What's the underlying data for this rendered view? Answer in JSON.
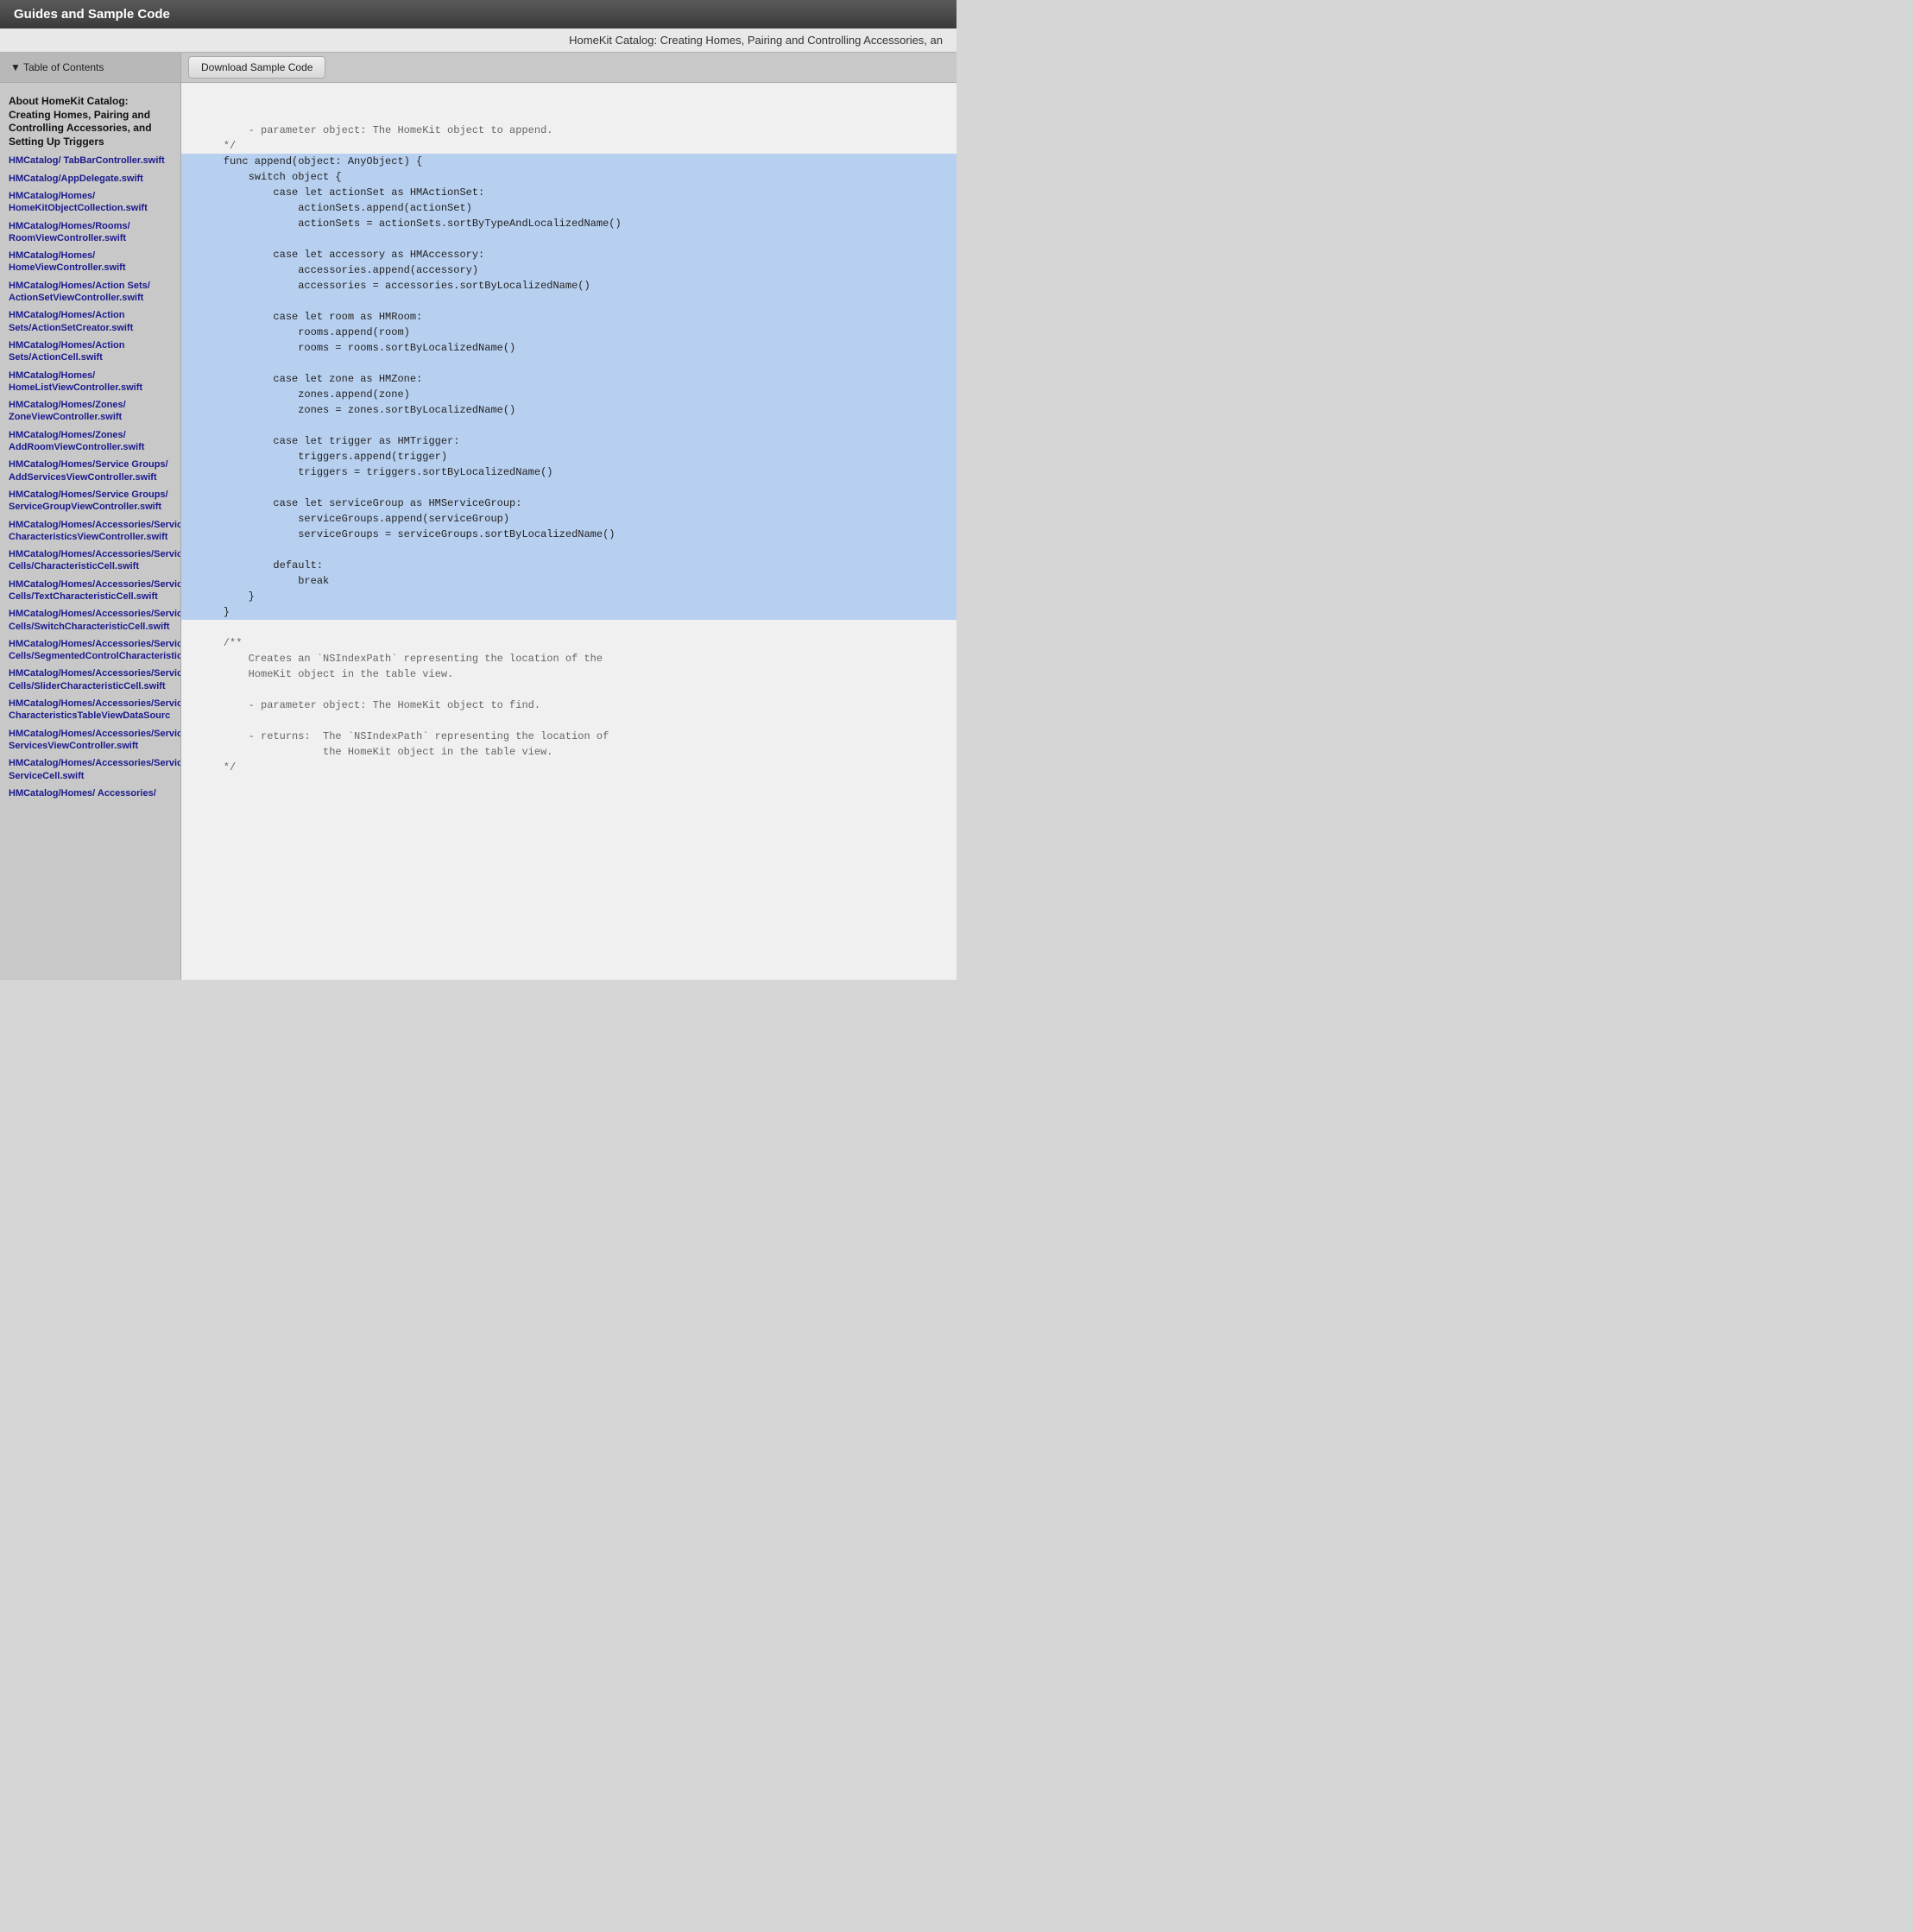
{
  "title_bar": {
    "label": "Guides and Sample Code"
  },
  "header_bar": {
    "page_title": "HomeKit Catalog: Creating Homes, Pairing and Controlling Accessories, an"
  },
  "toolbar": {
    "toc_toggle_label": "▼  Table of Contents",
    "download_button_label": "Download Sample Code"
  },
  "sidebar": {
    "sections": [
      {
        "id": "about",
        "label": "About HomeKit Catalog: Creating Homes, Pairing and Controlling Accessories, and Setting Up Triggers"
      }
    ],
    "items": [
      {
        "id": "tabbar",
        "label": "HMCatalog/\nTabBarController.swift"
      },
      {
        "id": "appdelegate",
        "label": "HMCatalog/AppDelegate.swift"
      },
      {
        "id": "homekitobject",
        "label": "HMCatalog/Homes/\nHomeKitObjectCollection.swift"
      },
      {
        "id": "roomviewcontroller",
        "label": "HMCatalog/Homes/Rooms/\nRoomViewController.swift"
      },
      {
        "id": "homeviewcontroller",
        "label": "HMCatalog/Homes/\nHomeViewController.swift"
      },
      {
        "id": "actionsetviewcontroller",
        "label": "HMCatalog/Homes/Action Sets/\nActionSetViewController.swift"
      },
      {
        "id": "actionsetcreator",
        "label": "HMCatalog/Homes/Action Sets/ActionSetCreator.swift"
      },
      {
        "id": "actioncell",
        "label": "HMCatalog/Homes/Action Sets/ActionCell.swift"
      },
      {
        "id": "homelistviewcontroller",
        "label": "HMCatalog/Homes/\nHomeListViewController.swift"
      },
      {
        "id": "zoneviewcontroller",
        "label": "HMCatalog/Homes/Zones/\nZoneViewController.swift"
      },
      {
        "id": "addroomviewcontroller",
        "label": "HMCatalog/Homes/Zones/\nAddRoomViewController.swift"
      },
      {
        "id": "addservicesviewcontroller",
        "label": "HMCatalog/Homes/Service Groups/\nAddServicesViewController.swift"
      },
      {
        "id": "servicegroupviewcontroller",
        "label": "HMCatalog/Homes/Service Groups/\nServiceGroupViewController.swift"
      },
      {
        "id": "characteristicsviewcontroller",
        "label": "HMCatalog/Homes/Accessories/Services/\nCharacteristicsViewController.swift"
      },
      {
        "id": "characteristiccell",
        "label": "HMCatalog/Homes/Accessories/Services/Characteristic Cells/CharacteristicCell.swift"
      },
      {
        "id": "textcharacteristiccell",
        "label": "HMCatalog/Homes/Accessories/Services/Characteristic Cells/TextCharacteristicCell.swift"
      },
      {
        "id": "switchcharacteristiccell",
        "label": "HMCatalog/Homes/Accessories/Services/Characteristic Cells/SwitchCharacteristicCell.swift"
      },
      {
        "id": "segmentedcontrolcharacteristiccell",
        "label": "HMCatalog/Homes/Accessories/Services/Characteristic Cells/SegmentedControlCharacteristicCe"
      },
      {
        "id": "slidercharacteristiccell",
        "label": "HMCatalog/Homes/Accessories/Services/Characteristic Cells/SliderCharacteristicCell.swift"
      },
      {
        "id": "characteristicstabledatasource",
        "label": "HMCatalog/Homes/Accessories/Services/\nCharacteristicsTableViewDataSourc"
      },
      {
        "id": "servicesviewcontroller",
        "label": "HMCatalog/Homes/Accessories/Services/\nServicesViewController.swift"
      },
      {
        "id": "servicecell",
        "label": "HMCatalog/Homes/Accessories/Services/\nServiceCell.swift"
      },
      {
        "id": "accessories2",
        "label": "HMCatalog/Homes/\nAccessories/"
      }
    ]
  },
  "code": {
    "lines": [
      {
        "text": "        - parameter object: The HomeKit object to append.",
        "highlight": false,
        "type": "comment"
      },
      {
        "text": "    */",
        "highlight": false,
        "type": "comment"
      },
      {
        "text": "    func append(object: AnyObject) {",
        "highlight": true,
        "type": "code"
      },
      {
        "text": "        switch object {",
        "highlight": true,
        "type": "code"
      },
      {
        "text": "            case let actionSet as HMActionSet:",
        "highlight": true,
        "type": "code"
      },
      {
        "text": "                actionSets.append(actionSet)",
        "highlight": true,
        "type": "code"
      },
      {
        "text": "                actionSets = actionSets.sortByTypeAndLocalizedName()",
        "highlight": true,
        "type": "code"
      },
      {
        "text": "",
        "highlight": true,
        "type": "code"
      },
      {
        "text": "            case let accessory as HMAccessory:",
        "highlight": true,
        "type": "code"
      },
      {
        "text": "                accessories.append(accessory)",
        "highlight": true,
        "type": "code"
      },
      {
        "text": "                accessories = accessories.sortByLocalizedName()",
        "highlight": true,
        "type": "code"
      },
      {
        "text": "",
        "highlight": true,
        "type": "code"
      },
      {
        "text": "            case let room as HMRoom:",
        "highlight": true,
        "type": "code"
      },
      {
        "text": "                rooms.append(room)",
        "highlight": true,
        "type": "code"
      },
      {
        "text": "                rooms = rooms.sortByLocalizedName()",
        "highlight": true,
        "type": "code"
      },
      {
        "text": "",
        "highlight": true,
        "type": "code"
      },
      {
        "text": "            case let zone as HMZone:",
        "highlight": true,
        "type": "code"
      },
      {
        "text": "                zones.append(zone)",
        "highlight": true,
        "type": "code"
      },
      {
        "text": "                zones = zones.sortByLocalizedName()",
        "highlight": true,
        "type": "code"
      },
      {
        "text": "",
        "highlight": true,
        "type": "code"
      },
      {
        "text": "            case let trigger as HMTrigger:",
        "highlight": true,
        "type": "code"
      },
      {
        "text": "                triggers.append(trigger)",
        "highlight": true,
        "type": "code"
      },
      {
        "text": "                triggers = triggers.sortByLocalizedName()",
        "highlight": true,
        "type": "code"
      },
      {
        "text": "",
        "highlight": true,
        "type": "code"
      },
      {
        "text": "            case let serviceGroup as HMServiceGroup:",
        "highlight": true,
        "type": "code"
      },
      {
        "text": "                serviceGroups.append(serviceGroup)",
        "highlight": true,
        "type": "code"
      },
      {
        "text": "                serviceGroups = serviceGroups.sortByLocalizedName()",
        "highlight": true,
        "type": "code"
      },
      {
        "text": "",
        "highlight": true,
        "type": "code"
      },
      {
        "text": "            default:",
        "highlight": true,
        "type": "code"
      },
      {
        "text": "                break",
        "highlight": true,
        "type": "code"
      },
      {
        "text": "        }",
        "highlight": true,
        "type": "code"
      },
      {
        "text": "    }",
        "highlight": true,
        "type": "code"
      },
      {
        "text": "",
        "highlight": false,
        "type": "code"
      },
      {
        "text": "    /**",
        "highlight": false,
        "type": "comment"
      },
      {
        "text": "        Creates an `NSIndexPath` representing the location of the",
        "highlight": false,
        "type": "comment"
      },
      {
        "text": "        HomeKit object in the table view.",
        "highlight": false,
        "type": "comment"
      },
      {
        "text": "",
        "highlight": false,
        "type": "comment"
      },
      {
        "text": "        - parameter object: The HomeKit object to find.",
        "highlight": false,
        "type": "comment"
      },
      {
        "text": "",
        "highlight": false,
        "type": "comment"
      },
      {
        "text": "        - returns:  The `NSIndexPath` representing the location of",
        "highlight": false,
        "type": "comment"
      },
      {
        "text": "                    the HomeKit object in the table view.",
        "highlight": false,
        "type": "comment"
      },
      {
        "text": "    */",
        "highlight": false,
        "type": "comment"
      }
    ]
  }
}
